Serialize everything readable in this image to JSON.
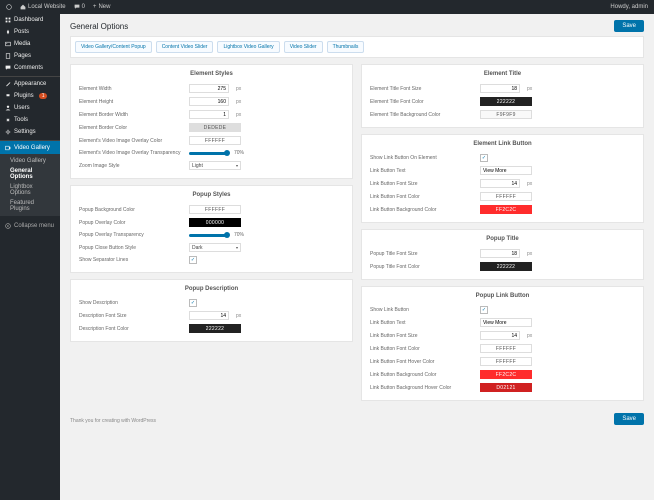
{
  "topbar": {
    "site": "Local Website",
    "comments": "0",
    "new": "New",
    "greeting": "Howdy, admin"
  },
  "sidebar": {
    "items": [
      {
        "label": "Dashboard",
        "icon": "dashboard"
      },
      {
        "label": "Posts",
        "icon": "pin"
      },
      {
        "label": "Media",
        "icon": "media"
      },
      {
        "label": "Pages",
        "icon": "page"
      },
      {
        "label": "Comments",
        "icon": "comment"
      },
      {
        "label": "Appearance",
        "icon": "brush"
      },
      {
        "label": "Plugins",
        "icon": "plug",
        "badge": "1"
      },
      {
        "label": "Users",
        "icon": "user"
      },
      {
        "label": "Tools",
        "icon": "tool"
      },
      {
        "label": "Settings",
        "icon": "gear"
      },
      {
        "label": "Video Gallery",
        "icon": "video"
      }
    ],
    "sub": [
      {
        "label": "Video Gallery"
      },
      {
        "label": "General Options"
      },
      {
        "label": "Lightbox Options"
      },
      {
        "label": "Featured Plugins"
      }
    ],
    "collapse": "Collapse menu"
  },
  "page": {
    "title": "General Options",
    "save": "Save"
  },
  "tabs": [
    "Video Gallery/Content Popup",
    "Content Video Slider",
    "Lightbox Video Gallery",
    "Video Slider",
    "Thumbnails"
  ],
  "panels": {
    "elementStyles": {
      "title": "Element Styles",
      "rows": [
        {
          "label": "Element Width",
          "value": "275",
          "type": "num",
          "unit": "px"
        },
        {
          "label": "Element Height",
          "value": "160",
          "type": "num",
          "unit": "px"
        },
        {
          "label": "Element Border Width",
          "value": "1",
          "type": "num",
          "unit": "px"
        },
        {
          "label": "Element Border Color",
          "value": "DEDEDE",
          "type": "swatch",
          "bg": "#DEDEDE",
          "fg": "#555"
        },
        {
          "label": "Element's Video Image Overlay Color",
          "value": "FFFFFF",
          "type": "swatch",
          "bg": "#FFFFFF",
          "fg": "#555"
        },
        {
          "label": "Element's Video Image Overlay Transparency",
          "value": "70%",
          "type": "slider"
        },
        {
          "label": "Zoom Image Style",
          "value": "Light",
          "type": "select"
        }
      ]
    },
    "popupStyles": {
      "title": "Popup Styles",
      "rows": [
        {
          "label": "Popup Background Color",
          "value": "FFFFFF",
          "type": "swatch",
          "bg": "#FFFFFF",
          "fg": "#555"
        },
        {
          "label": "Popup Overlay Color",
          "value": "000000",
          "type": "swatch",
          "bg": "#000000",
          "fg": "#fff"
        },
        {
          "label": "Popup Overlay Transparency",
          "value": "70%",
          "type": "slider"
        },
        {
          "label": "Popup Close Button Style",
          "value": "Dark",
          "type": "select"
        },
        {
          "label": "Show Separator Lines",
          "value": "✓",
          "type": "check"
        }
      ]
    },
    "popupDescription": {
      "title": "Popup Description",
      "rows": [
        {
          "label": "Show Description",
          "value": "✓",
          "type": "check"
        },
        {
          "label": "Description Font Size",
          "value": "14",
          "type": "num",
          "unit": "px"
        },
        {
          "label": "Description Font Color",
          "value": "222222",
          "type": "swatch",
          "bg": "#222222",
          "fg": "#fff"
        }
      ]
    },
    "elementTitle": {
      "title": "Element Title",
      "rows": [
        {
          "label": "Element Title Font Size",
          "value": "18",
          "type": "num",
          "unit": "px"
        },
        {
          "label": "Element Title Font Color",
          "value": "222222",
          "type": "swatch",
          "bg": "#222222",
          "fg": "#fff"
        },
        {
          "label": "Element Title Background Color",
          "value": "F9F9F9",
          "type": "swatch",
          "bg": "#F9F9F9",
          "fg": "#555"
        }
      ]
    },
    "elementLinkButton": {
      "title": "Element Link Button",
      "rows": [
        {
          "label": "Show Link Button On Element",
          "value": "✓",
          "type": "check"
        },
        {
          "label": "Link Button Text",
          "value": "View More",
          "type": "text"
        },
        {
          "label": "Link Button Font Size",
          "value": "14",
          "type": "num",
          "unit": "px"
        },
        {
          "label": "Link Button Font Color",
          "value": "FFFFFF",
          "type": "swatch",
          "bg": "#FFFFFF",
          "fg": "#555"
        },
        {
          "label": "Link Button Background Color",
          "value": "FF2C2C",
          "type": "swatch",
          "bg": "#FF2C2C",
          "fg": "#fff"
        }
      ]
    },
    "popupTitle": {
      "title": "Popup Title",
      "rows": [
        {
          "label": "Popup Title Font Size",
          "value": "18",
          "type": "num",
          "unit": "px"
        },
        {
          "label": "Popup Title Font Color",
          "value": "222222",
          "type": "swatch",
          "bg": "#222222",
          "fg": "#fff"
        }
      ]
    },
    "popupLinkButton": {
      "title": "Popup Link Button",
      "rows": [
        {
          "label": "Show Link Button",
          "value": "✓",
          "type": "check"
        },
        {
          "label": "Link Button Text",
          "value": "View More",
          "type": "text"
        },
        {
          "label": "Link Button Font Size",
          "value": "14",
          "type": "num",
          "unit": "px"
        },
        {
          "label": "Link Button Font Color",
          "value": "FFFFFF",
          "type": "swatch",
          "bg": "#FFFFFF",
          "fg": "#555"
        },
        {
          "label": "Link Button Font Hover Color",
          "value": "FFFFFF",
          "type": "swatch",
          "bg": "#FFFFFF",
          "fg": "#555"
        },
        {
          "label": "Link Button Background Color",
          "value": "FF2C2C",
          "type": "swatch",
          "bg": "#FF2C2C",
          "fg": "#fff"
        },
        {
          "label": "Link Button Background Hover Color",
          "value": "D02121",
          "type": "swatch",
          "bg": "#D02121",
          "fg": "#fff"
        }
      ]
    }
  },
  "footer": {
    "credit": "Thank you for creating with WordPress"
  }
}
